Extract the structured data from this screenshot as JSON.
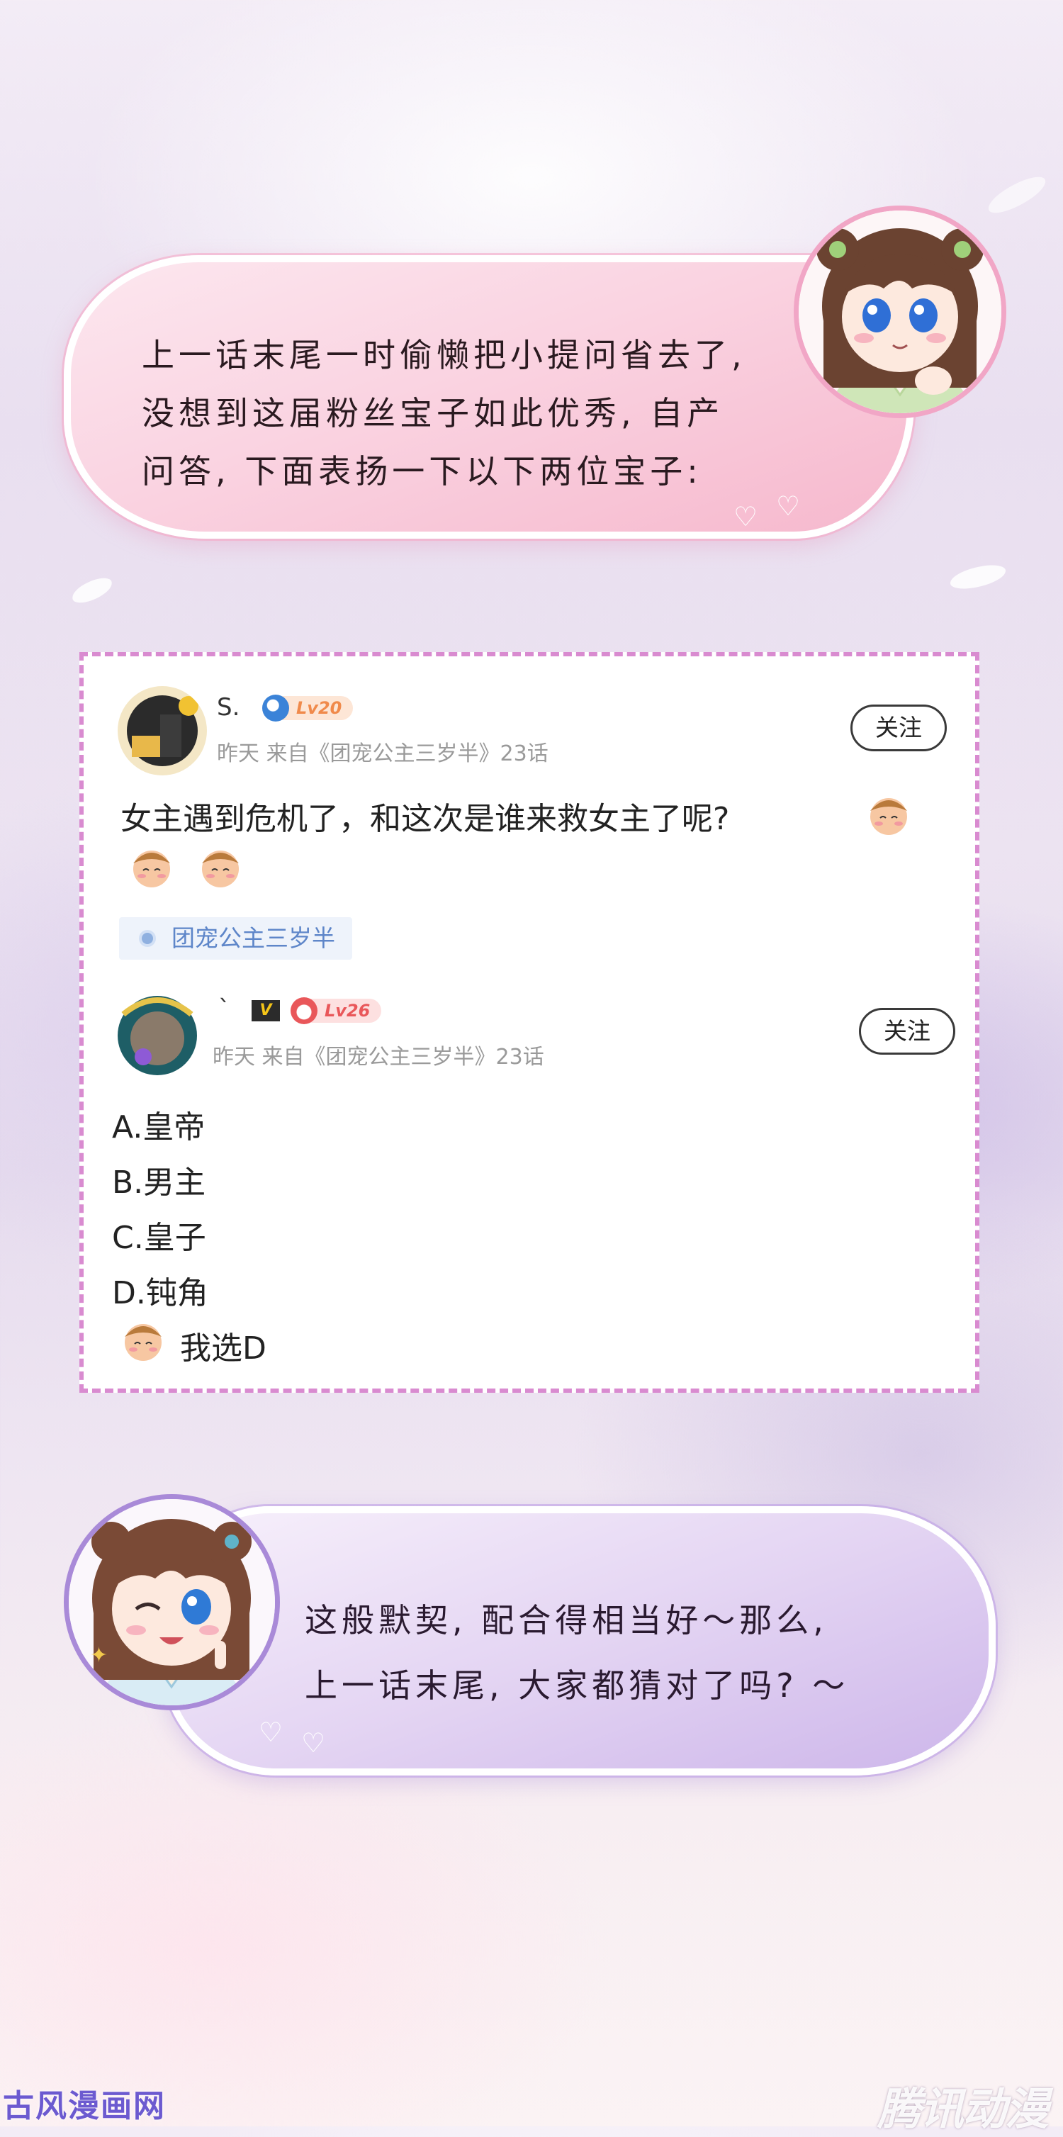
{
  "top_bubble": {
    "lines": [
      "上一话末尾一时偷懒把小提问省去了,",
      "没想到这届粉丝宝子如此优秀, 自产",
      "问答, 下面表扬一下以下两位宝子:"
    ]
  },
  "comments": [
    {
      "username": "S.",
      "level": "Lv20",
      "meta": "昨天 来自《团宠公主三岁半》23话",
      "follow_label": "关注",
      "content_line1": "女主遇到危机了，和这次是谁来救女主了呢?",
      "tag_label": "团宠公主三岁半"
    },
    {
      "username": "`",
      "vip_badge": "V",
      "level": "Lv26",
      "meta": "昨天 来自《团宠公主三岁半》23话",
      "follow_label": "关注",
      "options": [
        "A.皇帝",
        "B.男主",
        "C.皇子",
        "D.钝角"
      ],
      "final_line": "我选D"
    }
  ],
  "bottom_bubble": {
    "lines": [
      "这般默契, 配合得相当好～那么,",
      "上一话末尾, 大家都猜对了吗? ～"
    ]
  },
  "watermarks": {
    "left": "古风漫画网",
    "right": "腾讯动漫"
  },
  "colors": {
    "top_bubble": "#f6b8cd",
    "bottom_bubble": "#cdb6ea",
    "card_border": "#d98bd0",
    "level_orange": "#f08a4b",
    "level_red": "#e9575a",
    "tag_text": "#5e86c9"
  }
}
